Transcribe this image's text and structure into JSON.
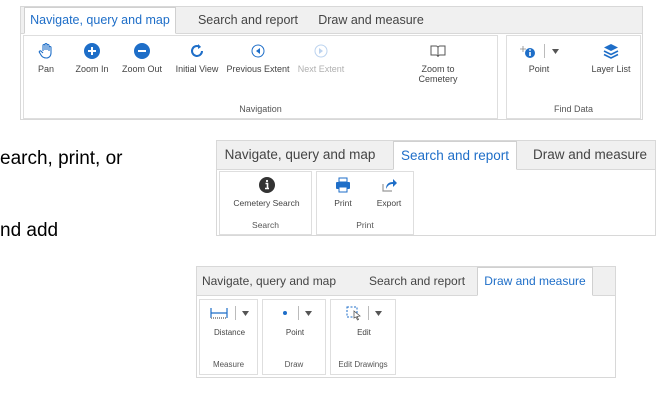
{
  "background_text": {
    "line1": "earch, print, or",
    "line2": "nd add"
  },
  "panel1": {
    "tabs": [
      {
        "label": "Navigate, query and map",
        "active": true
      },
      {
        "label": "Search and report",
        "active": false
      },
      {
        "label": "Draw and measure",
        "active": false
      }
    ],
    "groups": {
      "navigation": {
        "label": "Navigation",
        "tools": [
          {
            "label": "Pan",
            "icon": "hand-icon"
          },
          {
            "label": "Zoom In",
            "icon": "zoom-in-icon"
          },
          {
            "label": "Zoom Out",
            "icon": "zoom-out-icon"
          },
          {
            "label": "Initial View",
            "icon": "refresh-icon"
          },
          {
            "label": "Previous Extent",
            "icon": "arrow-left-icon"
          },
          {
            "label": "Next Extent",
            "icon": "arrow-right-icon",
            "disabled": true
          },
          {
            "label": "Zoom to Cemetery",
            "icon": "book-icon"
          }
        ]
      },
      "find_data": {
        "label": "Find Data",
        "tools": [
          {
            "label": "Point",
            "icon": "identify-point-icon"
          },
          {
            "label": "Layer List",
            "icon": "layers-icon"
          }
        ]
      }
    }
  },
  "panel2": {
    "tabs": [
      {
        "label": "Navigate, query and map",
        "active": false
      },
      {
        "label": "Search and report",
        "active": true
      },
      {
        "label": "Draw and measure",
        "active": false
      }
    ],
    "groups": {
      "search": {
        "label": "Search",
        "tools": [
          {
            "label": "Cemetery Search",
            "icon": "info-icon"
          }
        ]
      },
      "print": {
        "label": "Print",
        "tools": [
          {
            "label": "Print",
            "icon": "printer-icon"
          },
          {
            "label": "Export",
            "icon": "export-icon"
          }
        ]
      }
    }
  },
  "panel3": {
    "tabs": [
      {
        "label": "Navigate, query and map",
        "active": false
      },
      {
        "label": "Search and report",
        "active": false
      },
      {
        "label": "Draw and measure",
        "active": true
      }
    ],
    "groups": {
      "measure": {
        "label": "Measure",
        "tools": [
          {
            "label": "Distance",
            "icon": "ruler-icon"
          }
        ]
      },
      "draw": {
        "label": "Draw",
        "tools": [
          {
            "label": "Point",
            "icon": "dot-icon"
          }
        ]
      },
      "edit_drawings": {
        "label": "Edit Drawings",
        "tools": [
          {
            "label": "Edit",
            "icon": "edit-select-icon"
          }
        ]
      }
    }
  },
  "colors": {
    "accent": "#1e6ec8",
    "tab_bg": "#f0f0f0",
    "border": "#d8d8d8",
    "text": "#444444"
  }
}
